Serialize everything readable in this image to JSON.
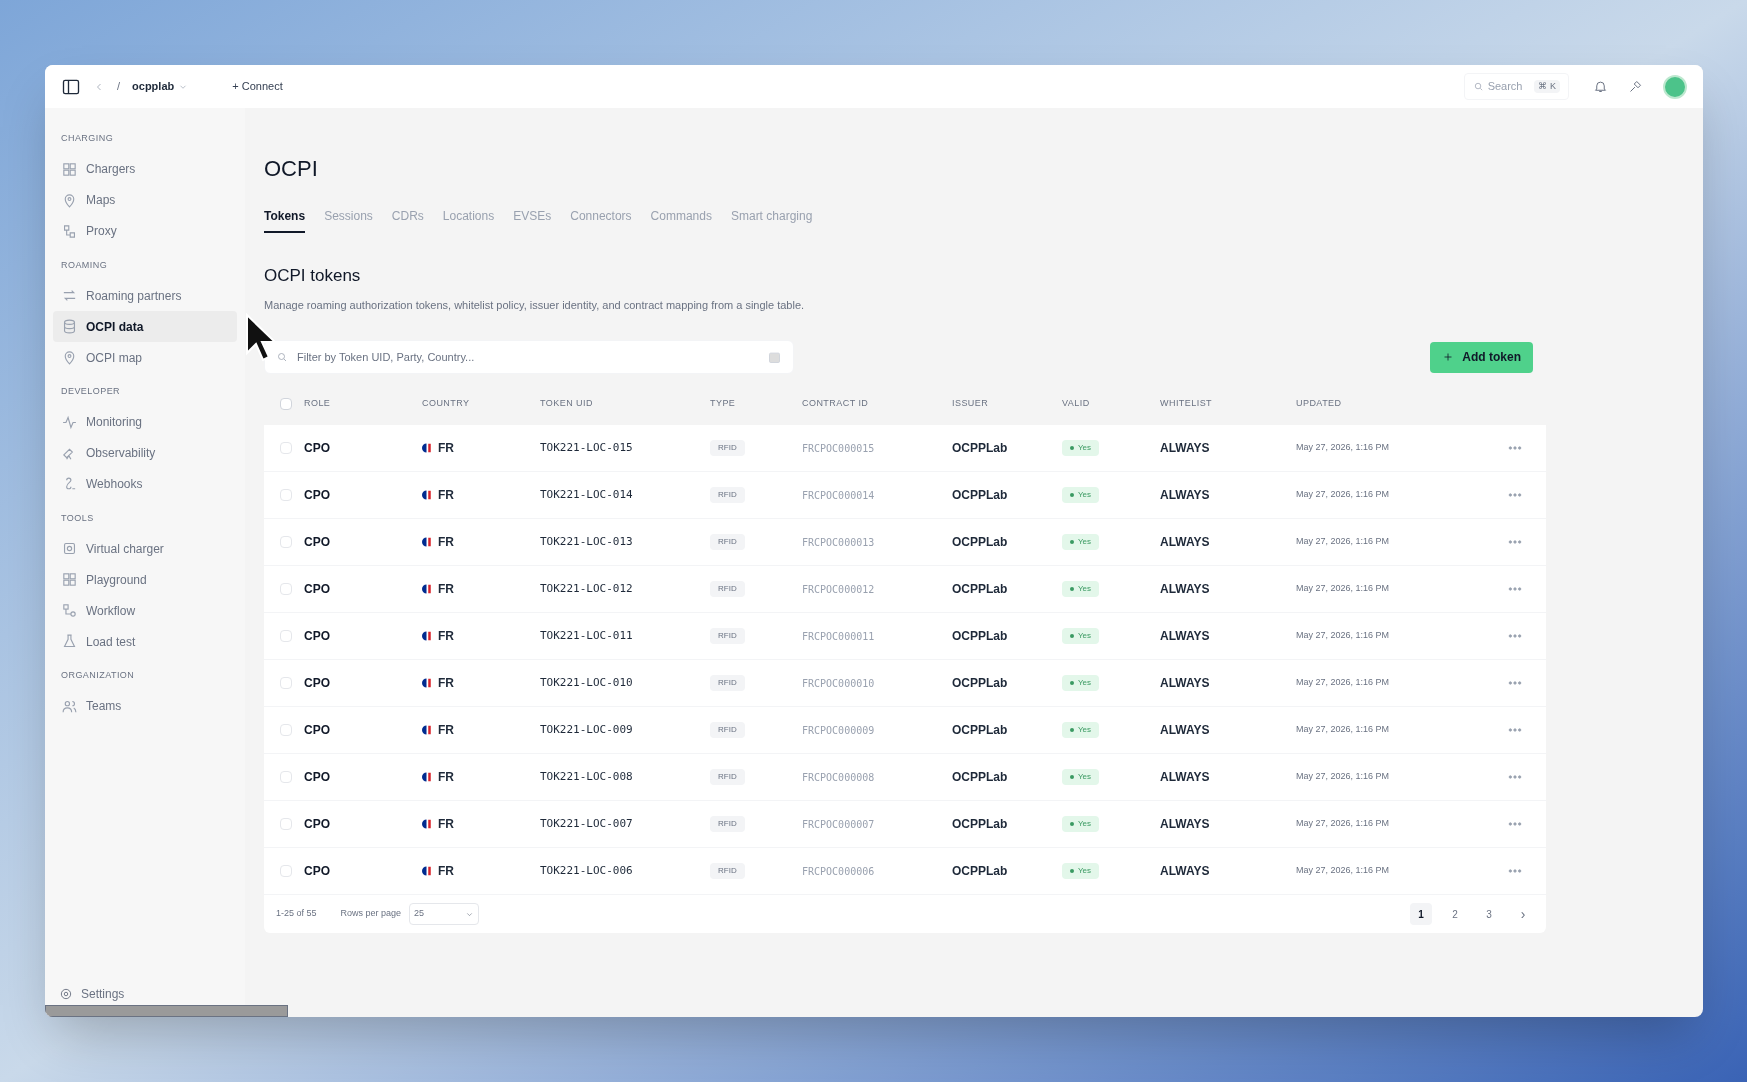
{
  "topbar": {
    "separator": "/",
    "workspace": "ocpplab",
    "connect": "+ Connect",
    "search": "Search",
    "shortcut": "⌘ K"
  },
  "sidebar": {
    "sections": [
      {
        "title": "CHARGING",
        "items": [
          {
            "label": "Chargers",
            "selected": false
          },
          {
            "label": "Maps",
            "selected": false
          },
          {
            "label": "Proxy",
            "selected": false
          }
        ]
      },
      {
        "title": "ROAMING",
        "items": [
          {
            "label": "Roaming partners",
            "selected": false
          },
          {
            "label": "OCPI data",
            "selected": true
          },
          {
            "label": "OCPI map",
            "selected": false
          }
        ]
      },
      {
        "title": "DEVELOPER",
        "items": [
          {
            "label": "Monitoring",
            "selected": false
          },
          {
            "label": "Observability",
            "selected": false
          },
          {
            "label": "Webhooks",
            "selected": false
          }
        ]
      },
      {
        "title": "TOOLS",
        "items": [
          {
            "label": "Virtual charger",
            "selected": false
          },
          {
            "label": "Playground",
            "selected": false
          },
          {
            "label": "Workflow",
            "selected": false
          },
          {
            "label": "Load test",
            "selected": false
          }
        ]
      },
      {
        "title": "ORGANIZATION",
        "items": [
          {
            "label": "Teams",
            "selected": false
          }
        ]
      }
    ],
    "footer": "Settings"
  },
  "page": {
    "title": "OCPI",
    "tabs": [
      {
        "label": "Tokens",
        "selected": true
      },
      {
        "label": "Sessions",
        "selected": false
      },
      {
        "label": "CDRs",
        "selected": false
      },
      {
        "label": "Locations",
        "selected": false
      },
      {
        "label": "EVSEs",
        "selected": false
      },
      {
        "label": "Connectors",
        "selected": false
      },
      {
        "label": "Commands",
        "selected": false
      },
      {
        "label": "Smart charging",
        "selected": false
      }
    ],
    "section_title": "OCPI tokens",
    "description": "Manage roaming authorization tokens, whitelist policy, issuer identity, and contract mapping from a single table.",
    "search": {
      "placeholder": "Filter by Token UID, Party, Country..."
    },
    "add_button": "Add token"
  },
  "table": {
    "header_checked": false,
    "columns": [
      "ROLE",
      "COUNTRY",
      "TOKEN UID",
      "TYPE",
      "CONTRACT ID",
      "ISSUER",
      "VALID",
      "WHITELIST",
      "UPDATED"
    ],
    "rows": [
      {
        "role": "CPO",
        "country": "FR",
        "uid": "TOK221-LOC-015",
        "type": "RFID",
        "contract": "FRCPOC000015",
        "issuer": "OCPPLab",
        "valid": "Yes",
        "whitelist": "ALWAYS",
        "updated": "May 27, 2026, 1:16 PM",
        "checked": false
      },
      {
        "role": "CPO",
        "country": "FR",
        "uid": "TOK221-LOC-014",
        "type": "RFID",
        "contract": "FRCPOC000014",
        "issuer": "OCPPLab",
        "valid": "Yes",
        "whitelist": "ALWAYS",
        "updated": "May 27, 2026, 1:16 PM",
        "checked": false
      },
      {
        "role": "CPO",
        "country": "FR",
        "uid": "TOK221-LOC-013",
        "type": "RFID",
        "contract": "FRCPOC000013",
        "issuer": "OCPPLab",
        "valid": "Yes",
        "whitelist": "ALWAYS",
        "updated": "May 27, 2026, 1:16 PM",
        "checked": false
      },
      {
        "role": "CPO",
        "country": "FR",
        "uid": "TOK221-LOC-012",
        "type": "RFID",
        "contract": "FRCPOC000012",
        "issuer": "OCPPLab",
        "valid": "Yes",
        "whitelist": "ALWAYS",
        "updated": "May 27, 2026, 1:16 PM",
        "checked": false
      },
      {
        "role": "CPO",
        "country": "FR",
        "uid": "TOK221-LOC-011",
        "type": "RFID",
        "contract": "FRCPOC000011",
        "issuer": "OCPPLab",
        "valid": "Yes",
        "whitelist": "ALWAYS",
        "updated": "May 27, 2026, 1:16 PM",
        "checked": false
      },
      {
        "role": "CPO",
        "country": "FR",
        "uid": "TOK221-LOC-010",
        "type": "RFID",
        "contract": "FRCPOC000010",
        "issuer": "OCPPLab",
        "valid": "Yes",
        "whitelist": "ALWAYS",
        "updated": "May 27, 2026, 1:16 PM",
        "checked": false
      },
      {
        "role": "CPO",
        "country": "FR",
        "uid": "TOK221-LOC-009",
        "type": "RFID",
        "contract": "FRCPOC000009",
        "issuer": "OCPPLab",
        "valid": "Yes",
        "whitelist": "ALWAYS",
        "updated": "May 27, 2026, 1:16 PM",
        "checked": false
      },
      {
        "role": "CPO",
        "country": "FR",
        "uid": "TOK221-LOC-008",
        "type": "RFID",
        "contract": "FRCPOC000008",
        "issuer": "OCPPLab",
        "valid": "Yes",
        "whitelist": "ALWAYS",
        "updated": "May 27, 2026, 1:16 PM",
        "checked": false
      },
      {
        "role": "CPO",
        "country": "FR",
        "uid": "TOK221-LOC-007",
        "type": "RFID",
        "contract": "FRCPOC000007",
        "issuer": "OCPPLab",
        "valid": "Yes",
        "whitelist": "ALWAYS",
        "updated": "May 27, 2026, 1:16 PM",
        "checked": false
      },
      {
        "role": "CPO",
        "country": "FR",
        "uid": "TOK221-LOC-006",
        "type": "RFID",
        "contract": "FRCPOC000006",
        "issuer": "OCPPLab",
        "valid": "Yes",
        "whitelist": "ALWAYS",
        "updated": "May 27, 2026, 1:16 PM",
        "checked": false
      }
    ],
    "range": "1-25 of 55",
    "rows_per_page_label": "Rows per page",
    "rows_per_page": "25",
    "pages": [
      {
        "label": "1",
        "selected": true
      },
      {
        "label": "2",
        "selected": false
      },
      {
        "label": "3",
        "selected": false
      }
    ],
    "next": "›"
  }
}
